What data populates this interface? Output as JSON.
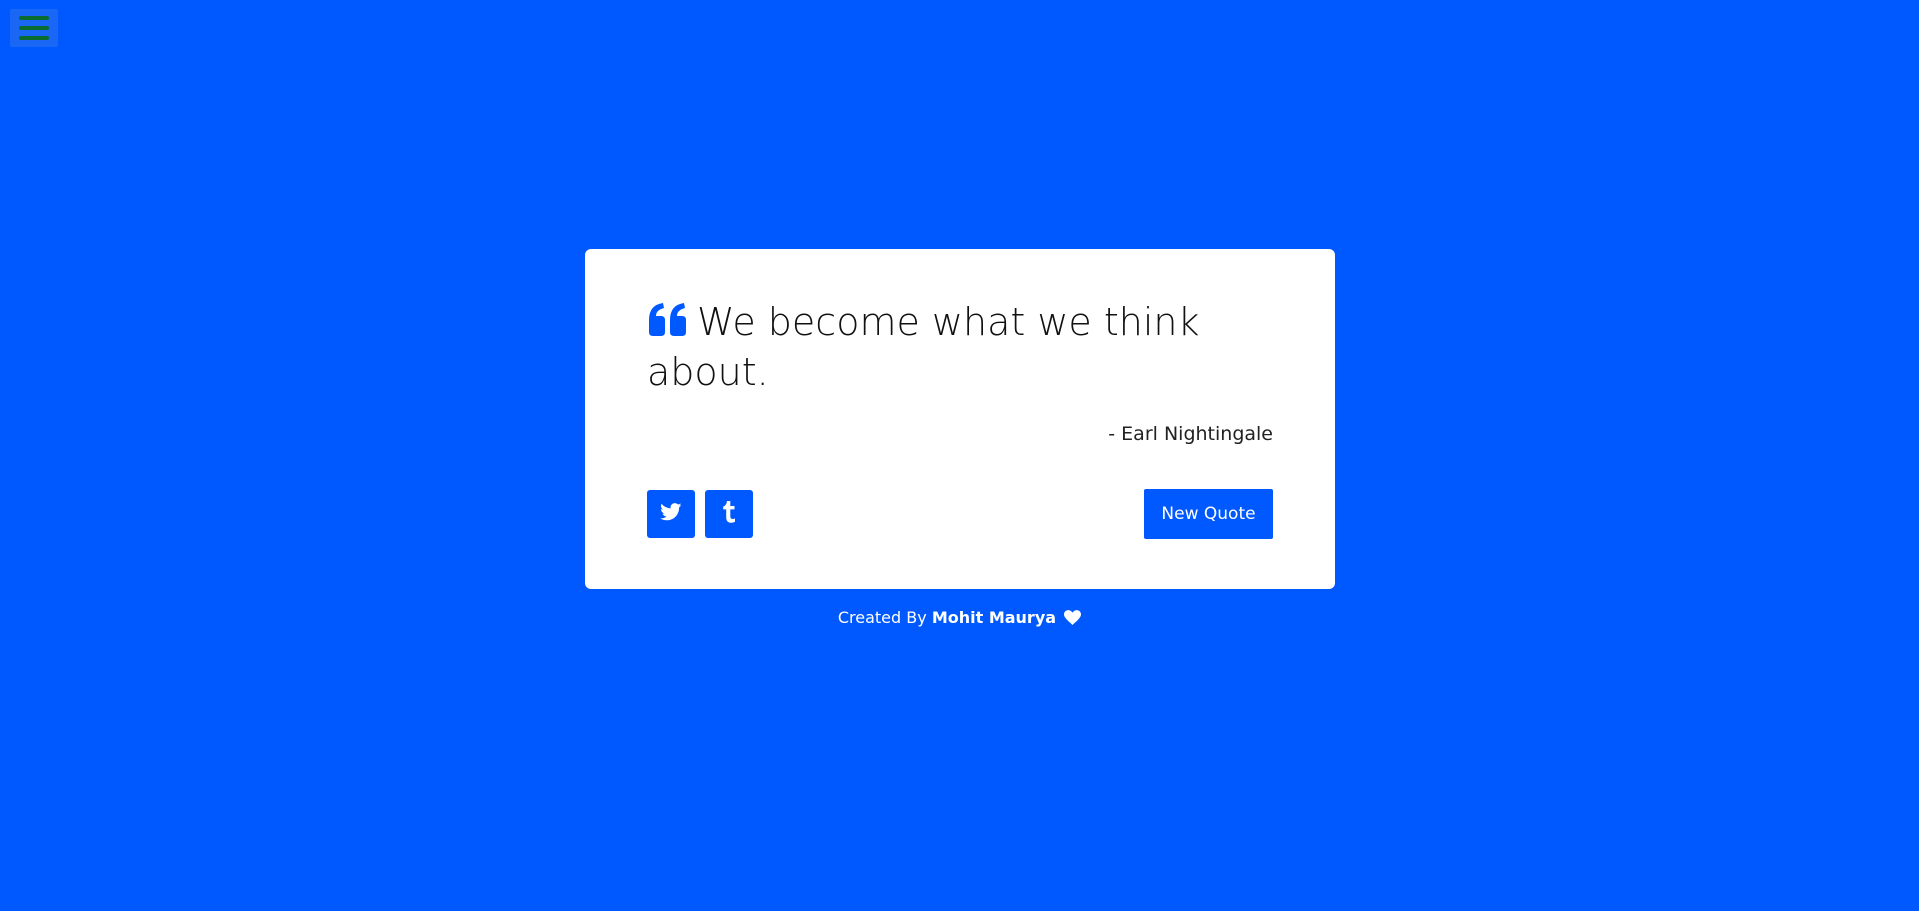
{
  "menu": {
    "icon": "hamburger-menu-icon"
  },
  "quote": {
    "text": "We become what we think about.",
    "author": "- Earl Nightingale",
    "icon": "quote-left-icon"
  },
  "actions": {
    "twitter_icon": "twitter-icon",
    "tumblr_icon": "tumblr-icon",
    "new_quote_label": "New Quote"
  },
  "footer": {
    "prefix": "Created By",
    "author_link": "Mohit Maurya",
    "icon": "heart-icon"
  },
  "colors": {
    "background": "#0059ff",
    "card": "#ffffff",
    "accent": "#0059ff",
    "menu_bars": "#0a6b2e"
  }
}
